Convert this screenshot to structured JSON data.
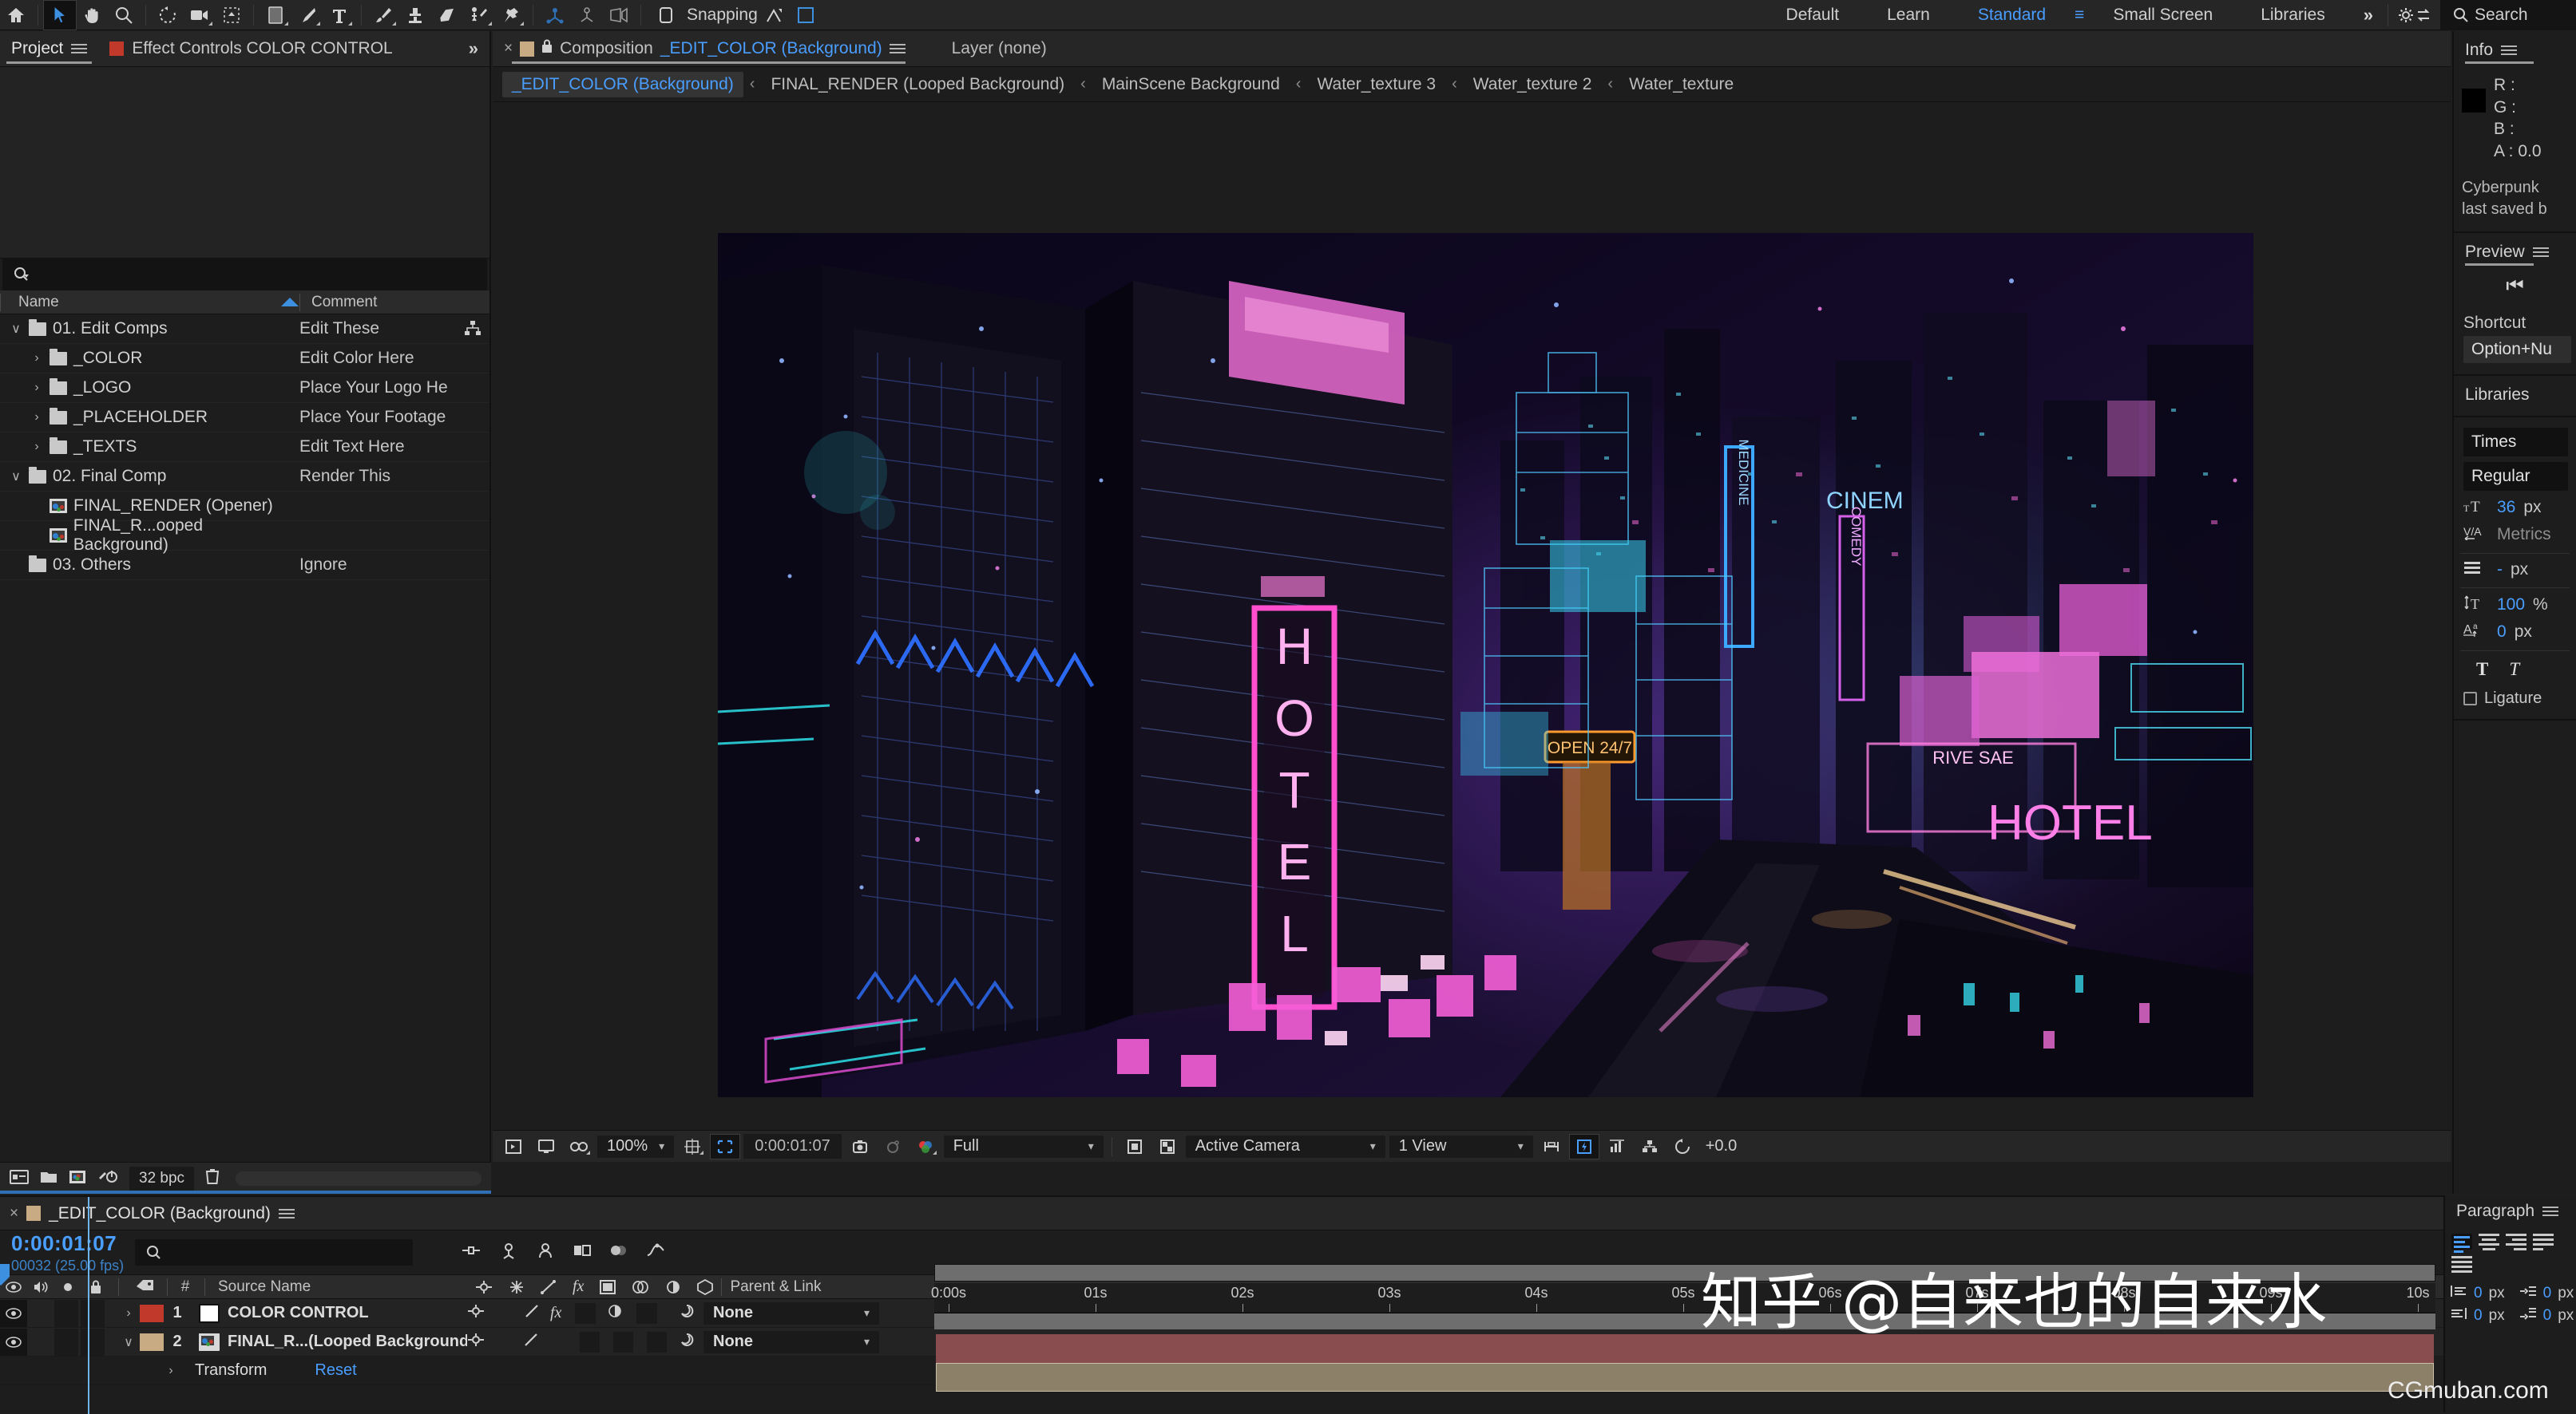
{
  "toolbar": {
    "icons": [
      "home-icon",
      "selection-tool-icon",
      "hand-tool-icon",
      "zoom-tool-icon",
      "rotation-tool-icon",
      "camera-tool-icon",
      "pan-behind-tool-icon",
      "shape-tool-icon",
      "pen-tool-icon",
      "type-tool-icon",
      "brush-tool-icon",
      "clone-stamp-tool-icon",
      "eraser-tool-icon",
      "roto-brush-tool-icon",
      "puppet-pin-tool-icon",
      "unified-camera-icon",
      "orbit-null-icon",
      "pan-camera-icon"
    ],
    "snapping_label": "Snapping",
    "workspaces": [
      "Default",
      "Learn",
      "Standard",
      "Small Screen",
      "Libraries"
    ],
    "active_workspace": "Standard",
    "more_label": "»",
    "search_label": "Search"
  },
  "project": {
    "tabs": [
      {
        "label": "Project",
        "active": true,
        "has_swatch": false
      },
      {
        "label": "Effect Controls COLOR CONTROL",
        "active": false,
        "has_swatch": true
      }
    ],
    "more_label": "»",
    "search_placeholder": "",
    "columns": [
      "Name",
      "Comment"
    ],
    "rows": [
      {
        "name": "01. Edit Comps",
        "comment": "Edit These",
        "type": "folder",
        "indent": 0,
        "twisty": "v"
      },
      {
        "name": "_COLOR",
        "comment": "Edit Color Here",
        "type": "folder",
        "indent": 1,
        "twisty": ">"
      },
      {
        "name": "_LOGO",
        "comment": "Place Your Logo He",
        "type": "folder",
        "indent": 1,
        "twisty": ">"
      },
      {
        "name": "_PLACEHOLDER",
        "comment": "Place Your Footage",
        "type": "folder",
        "indent": 1,
        "twisty": ">"
      },
      {
        "name": "_TEXTS",
        "comment": "Edit Text Here",
        "type": "folder",
        "indent": 1,
        "twisty": ">"
      },
      {
        "name": "02. Final Comp",
        "comment": "Render This",
        "type": "folder",
        "indent": 0,
        "twisty": "v"
      },
      {
        "name": "FINAL_RENDER (Opener)",
        "comment": "",
        "type": "comp",
        "indent": 1,
        "twisty": ""
      },
      {
        "name": "FINAL_R...ooped Background)",
        "comment": "",
        "type": "comp",
        "indent": 1,
        "twisty": ""
      },
      {
        "name": "03. Others",
        "comment": "Ignore",
        "type": "folder",
        "indent": 0,
        "twisty": ""
      }
    ],
    "footer": {
      "bpc": "32 bpc"
    }
  },
  "comp": {
    "tab": {
      "close": "×",
      "prefix": "Composition",
      "name": "_EDIT_COLOR (Background)"
    },
    "layer_label": "Layer (none)",
    "breadcrumb": [
      "_EDIT_COLOR (Background)",
      "FINAL_RENDER (Looped Background)",
      "MainScene Background",
      "Water_texture 3",
      "Water_texture 2",
      "Water_texture"
    ],
    "breadcrumb_sep": "‹",
    "bottombar": {
      "zoom": "100%",
      "time": "0:00:01:07",
      "resolution": "Full",
      "camera": "Active Camera",
      "views": "1 View",
      "exposure": "+0.0"
    }
  },
  "viewer_scene": {
    "signs": [
      "HOTEL",
      "MEDICINE",
      "CINEM",
      "COMEDY",
      "OPEN 24/7",
      "RIVE SAE",
      "HOTEL"
    ]
  },
  "info": {
    "title": "Info",
    "channels": [
      "R :",
      "G :",
      "B :",
      "A :  0.0"
    ],
    "description_line1": "Cyberpunk",
    "description_line2": "last saved b"
  },
  "preview": {
    "title": "Preview",
    "shortcut_label": "Shortcut",
    "shortcut_value": "Option+Nu"
  },
  "libraries": {
    "title": "Libraries"
  },
  "character": {
    "font_family": "Times",
    "font_style": "Regular",
    "font_size": "36",
    "font_size_unit": "px",
    "tracking": "Metrics",
    "leading": "-",
    "leading_unit": "px",
    "vertical_scale": "100",
    "vertical_scale_unit": "%",
    "baseline_shift": "0",
    "baseline_shift_unit": "px",
    "style_buttons": [
      "T",
      "T"
    ],
    "ligatures_label": "Ligature"
  },
  "timeline": {
    "tab_name": "_EDIT_COLOR (Background)",
    "current_time": "0:00:01:07",
    "frame_info": "00032 (25.00 fps)",
    "search_placeholder": "",
    "columns": {
      "num": "#",
      "source_name": "Source Name",
      "parent_link": "Parent & Link"
    },
    "layers": [
      {
        "num": "1",
        "name": "COLOR CONTROL",
        "label_color": "#c0392b",
        "twisty": ">",
        "parent": "None",
        "icon": "solid-icon"
      },
      {
        "num": "2",
        "name": "FINAL_R...(Looped Background)",
        "label_color": "#c8ab82",
        "twisty": "v",
        "parent": "None",
        "icon": "comp-icon"
      }
    ],
    "transform_label": "Transform",
    "reset_label": "Reset",
    "ruler_ticks": [
      "0:00s",
      "01s",
      "02s",
      "03s",
      "04s",
      "05s",
      "06s",
      "07s",
      "08s",
      "09s",
      "10s"
    ]
  },
  "paragraph": {
    "title": "Paragraph",
    "indent_left": "0",
    "indent_right": "0",
    "indent_first": "0",
    "space_after": "0",
    "unit": "px"
  },
  "watermark": {
    "text": "知乎 @自来也的自来水",
    "site": "CGmuban.com"
  },
  "colors": {
    "accent_blue": "#4a9eff",
    "red_label": "#c0392b",
    "tan_label": "#c8ab82",
    "panel_bg": "#1d1d1d",
    "toolbar_bg": "#262626"
  }
}
